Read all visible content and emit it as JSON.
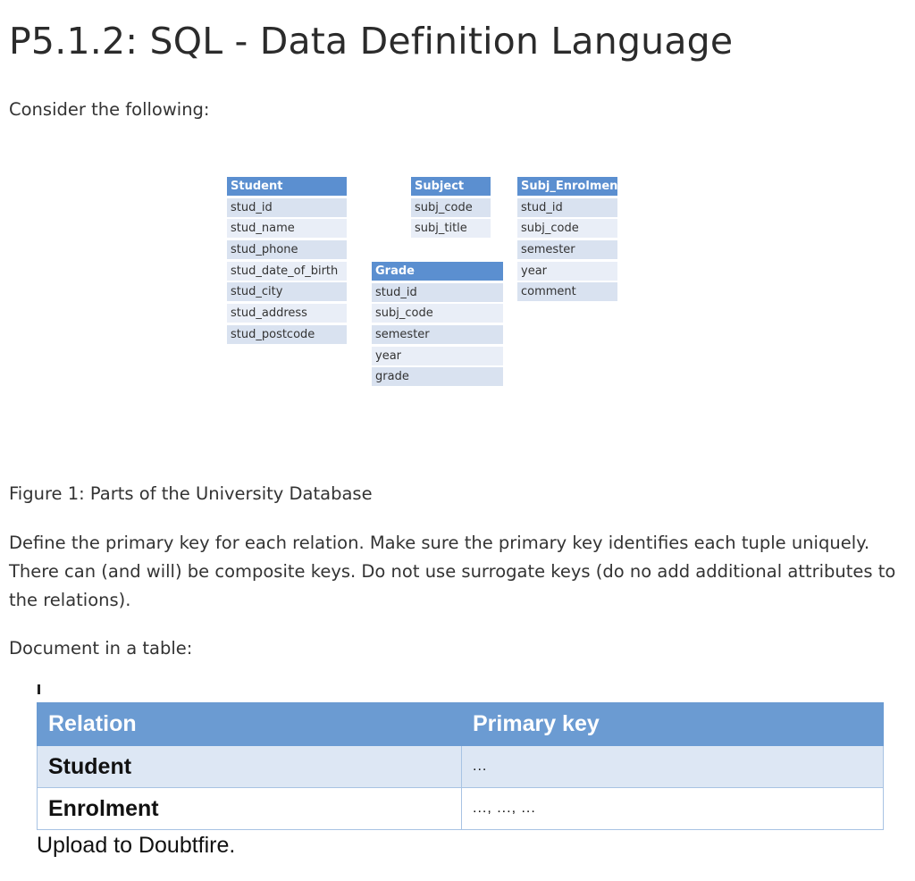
{
  "page": {
    "title": "P5.1.2: SQL - Data Definition Language",
    "intro": "Consider the following:",
    "caption": "Figure 1: Parts of the University Database",
    "instructions": "Define the primary key for each relation. Make sure the primary key identifies each tuple uniquely. There can (and will) be composite keys. Do not use surrogate keys (do no add additional attributes to the relations).",
    "document_prompt": "Document in a table:",
    "upload_note": "Upload to Doubtfire."
  },
  "diagram": {
    "student": {
      "name": "Student",
      "fields": [
        "stud_id",
        "stud_name",
        "stud_phone",
        "stud_date_of_birth",
        "stud_city",
        "stud_address",
        "stud_postcode"
      ]
    },
    "subject": {
      "name": "Subject",
      "fields": [
        "subj_code",
        "subj_title"
      ]
    },
    "grade": {
      "name": "Grade",
      "fields": [
        "stud_id",
        "subj_code",
        "semester",
        "year",
        "grade"
      ]
    },
    "subj_enrolment": {
      "name": "Subj_Enrolment",
      "fields": [
        "stud_id",
        "subj_code",
        "semester",
        "year",
        "comment"
      ]
    }
  },
  "key_table": {
    "headers": [
      "Relation",
      "Primary key"
    ],
    "rows": [
      {
        "relation": "Student",
        "primary_key": "..."
      },
      {
        "relation": "Enrolment",
        "primary_key": "..., ..., ..."
      }
    ]
  }
}
